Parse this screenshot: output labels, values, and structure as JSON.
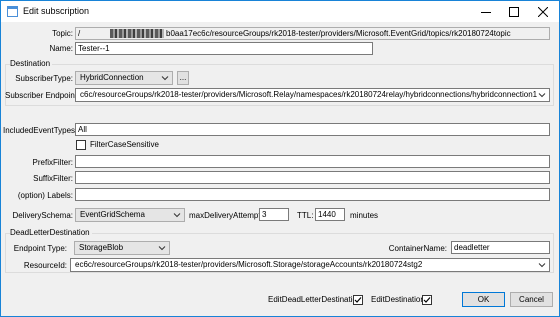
{
  "window": {
    "title": "Edit subscription"
  },
  "labels": {
    "topic": "Topic:",
    "name": "Name:",
    "destination": "Destination",
    "subscriber_type": "SubscriberType:",
    "subscriber_endpoint": "Subscriber Endpoint:",
    "included_event_types": "IncludedEventTypes:",
    "filter_case_sensitive": "FilterCaseSensitive",
    "prefix_filter": "PrefixFilter:",
    "suffix_filter": "SuffixFilter:",
    "option_labels": "(option) Labels:",
    "delivery_schema": "DeliverySchema:",
    "max_delivery_attempts": "maxDeliveryAttempts:",
    "ttl": "TTL:",
    "minutes": "minutes",
    "dead_letter_destination": "DeadLetterDestination",
    "endpoint_type": "Endpoint Type:",
    "container_name": "ContainerName:",
    "resource_id": "ResourceId:",
    "edit_dead_letter_destination": "EditDeadLetterDestination",
    "edit_destination": "EditDestination"
  },
  "values": {
    "topic_prefix": "/",
    "topic_suffix": "b0aa17ec6c/resourceGroups/rk2018-tester/providers/Microsoft.EventGrid/topics/rk20180724topic",
    "name": "Tester--1",
    "subscriber_type": "HybridConnection",
    "subscriber_endpoint": "c6c/resourceGroups/rk2018-tester/providers/Microsoft.Relay/namespaces/rk20180724relay/hybridconnections/hybridconnection1",
    "included_event_types": "All",
    "prefix_filter": "",
    "suffix_filter": "",
    "option_labels": "",
    "delivery_schema": "EventGridSchema",
    "max_delivery_attempts": "3",
    "ttl": "1440",
    "endpoint_type": "StorageBlob",
    "container_name": "deadletter",
    "resource_id": "ec6c/resourceGroups/rk2018-tester/providers/Microsoft.Storage/storageAccounts/rk20180724stg2"
  },
  "checkboxes": {
    "filter_case_sensitive": false,
    "edit_dead_letter_destination": true,
    "edit_destination": true
  },
  "buttons": {
    "browse": "...",
    "ok": "OK",
    "cancel": "Cancel"
  },
  "icons": {
    "app": "window-icon",
    "minimize": "minimize-icon",
    "maximize": "maximize-icon",
    "close": "close-icon",
    "dropdown": "chevron-down-icon"
  },
  "colors": {
    "window_border": "#1883d7",
    "default_button_border": "#0078d7",
    "background": "#f0f0f0"
  }
}
